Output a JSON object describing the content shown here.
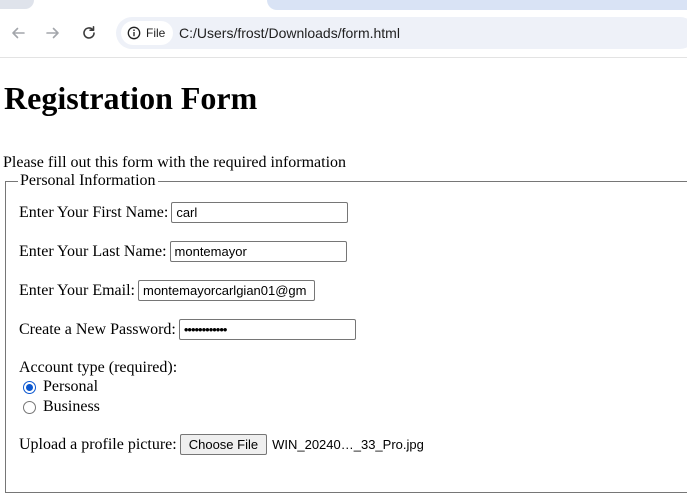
{
  "browser": {
    "security_chip": "File",
    "url": "C:/Users/frost/Downloads/form.html"
  },
  "page": {
    "title": "Registration Form",
    "intro": "Please fill out this form with the required information"
  },
  "form": {
    "legend": "Personal Information",
    "first_name": {
      "label": "Enter Your First Name:",
      "value": "carl"
    },
    "last_name": {
      "label": "Enter Your Last Name:",
      "value": "montemayor"
    },
    "email": {
      "label": "Enter Your Email:",
      "value": "montemayorcarlgian01@gm"
    },
    "password": {
      "label": "Create a New Password:",
      "value": "••••••••••••"
    },
    "account_type": {
      "label": "Account type (required):",
      "options": [
        {
          "label": "Personal",
          "checked": true
        },
        {
          "label": "Business",
          "checked": false
        }
      ]
    },
    "profile_picture": {
      "label": "Upload a profile picture:",
      "button": "Choose File",
      "file_name": "WIN_20240…_33_Pro.jpg"
    }
  },
  "icons": {
    "back": "arrow-left-icon",
    "forward": "arrow-right-icon",
    "reload": "reload-icon",
    "info": "info-icon"
  },
  "colors": {
    "radio_accent": "#0b57d0",
    "omnibox_bg": "#eef1f8",
    "tab_accent": "#d9e3f5"
  }
}
